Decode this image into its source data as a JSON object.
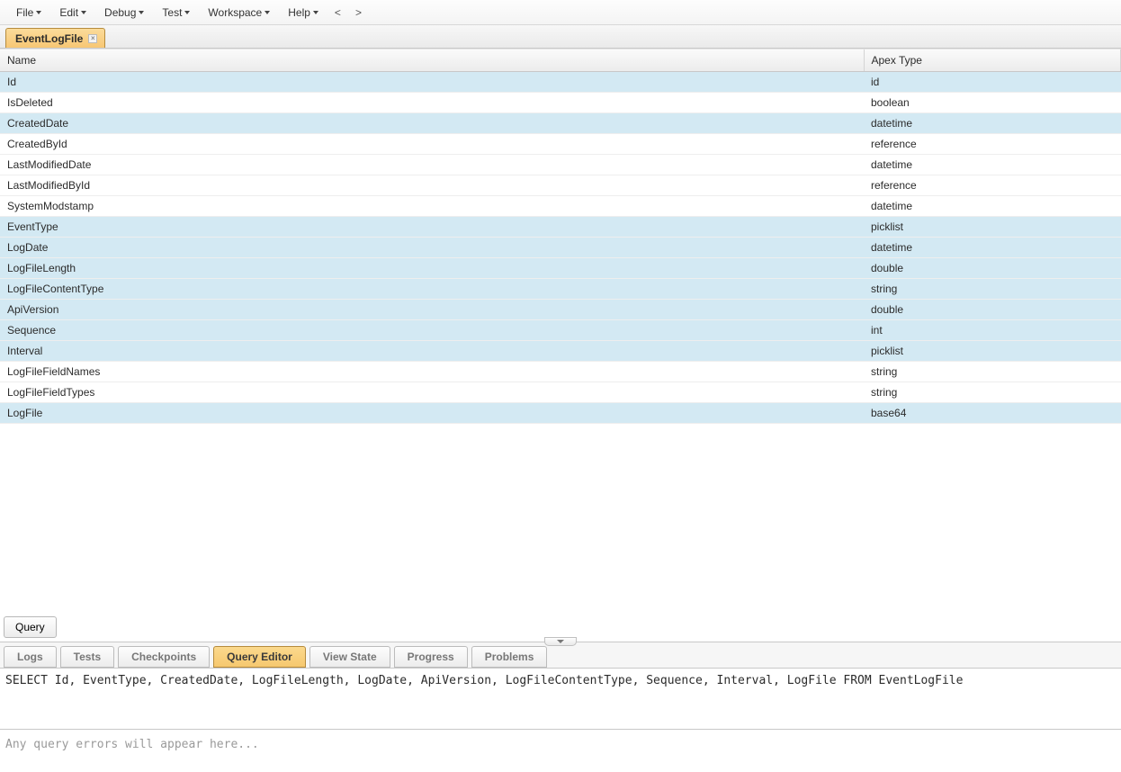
{
  "menu": {
    "items": [
      "File",
      "Edit",
      "Debug",
      "Test",
      "Workspace",
      "Help"
    ],
    "nav_back": "<",
    "nav_fwd": ">"
  },
  "tab": {
    "title": "EventLogFile"
  },
  "table": {
    "columns": [
      "Name",
      "Apex Type"
    ],
    "rows": [
      {
        "name": "Id",
        "type": "id",
        "sel": true
      },
      {
        "name": "IsDeleted",
        "type": "boolean",
        "sel": false
      },
      {
        "name": "CreatedDate",
        "type": "datetime",
        "sel": true
      },
      {
        "name": "CreatedById",
        "type": "reference",
        "sel": false
      },
      {
        "name": "LastModifiedDate",
        "type": "datetime",
        "sel": false
      },
      {
        "name": "LastModifiedById",
        "type": "reference",
        "sel": false
      },
      {
        "name": "SystemModstamp",
        "type": "datetime",
        "sel": false
      },
      {
        "name": "EventType",
        "type": "picklist",
        "sel": true
      },
      {
        "name": "LogDate",
        "type": "datetime",
        "sel": true
      },
      {
        "name": "LogFileLength",
        "type": "double",
        "sel": true
      },
      {
        "name": "LogFileContentType",
        "type": "string",
        "sel": true
      },
      {
        "name": "ApiVersion",
        "type": "double",
        "sel": true
      },
      {
        "name": "Sequence",
        "type": "int",
        "sel": true
      },
      {
        "name": "Interval",
        "type": "picklist",
        "sel": true
      },
      {
        "name": "LogFileFieldNames",
        "type": "string",
        "sel": false
      },
      {
        "name": "LogFileFieldTypes",
        "type": "string",
        "sel": false
      },
      {
        "name": "LogFile",
        "type": "base64",
        "sel": true
      }
    ]
  },
  "queryButton": "Query",
  "bottomTabs": {
    "items": [
      "Logs",
      "Tests",
      "Checkpoints",
      "Query Editor",
      "View State",
      "Progress",
      "Problems"
    ],
    "activeIndex": 3
  },
  "queryEditor": {
    "value": "SELECT Id, EventType, CreatedDate, LogFileLength, LogDate, ApiVersion, LogFileContentType, Sequence, Interval, LogFile FROM EventLogFile"
  },
  "errorsPlaceholder": "Any query errors will appear here..."
}
